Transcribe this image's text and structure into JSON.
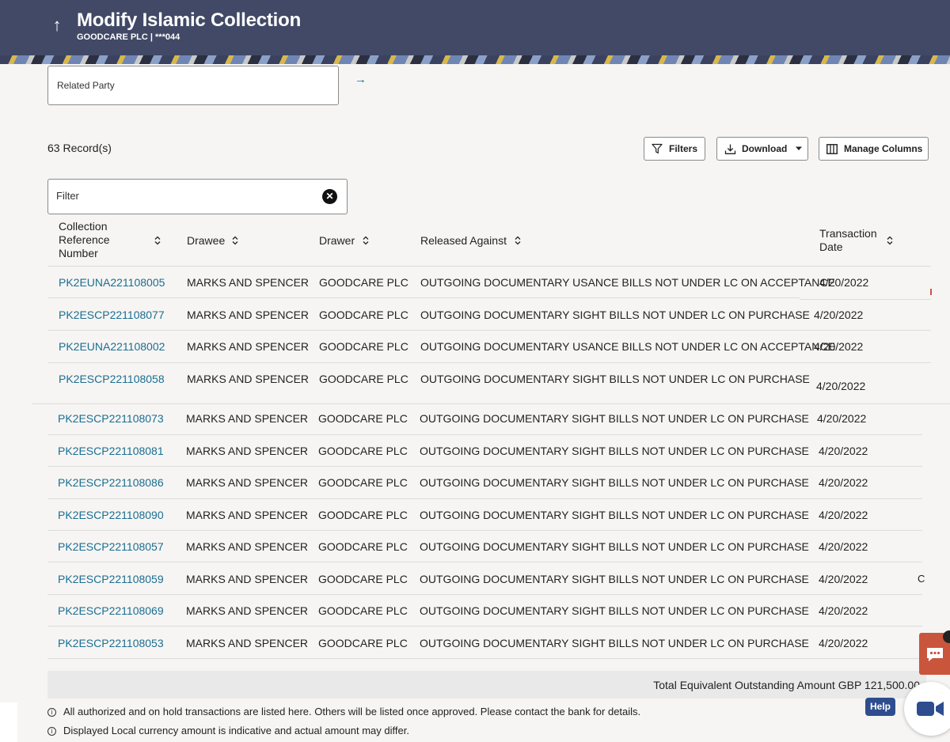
{
  "header": {
    "back_icon": "up-arrow-icon",
    "title": "Modify Islamic Collection",
    "subtitle": "GOODCARE PLC | ***044"
  },
  "search": {
    "related_party_label": "Related Party",
    "go_icon": "right-arrow-icon"
  },
  "toolbar": {
    "records": "63 Record(s)",
    "filters_label": "Filters",
    "download_label": "Download",
    "manage_columns_label": "Manage Columns"
  },
  "filter": {
    "placeholder": "Filter"
  },
  "table": {
    "columns": [
      "Collection Reference Number",
      "Drawee",
      "Drawer",
      "Released Against",
      "Transaction Date"
    ],
    "rows": [
      {
        "ref": "PK2EUNA221108005",
        "drawee": "MARKS AND SPENCER",
        "drawer": "GOODCARE PLC",
        "released": "OUTGOING DOCUMENTARY USANCE BILLS NOT UNDER LC ON ACCEPTANCE",
        "date": "4/20/2022"
      },
      {
        "ref": "PK2ESCP221108077",
        "drawee": "MARKS AND SPENCER",
        "drawer": "GOODCARE PLC",
        "released": "OUTGOING DOCUMENTARY SIGHT BILLS NOT UNDER LC ON PURCHASE",
        "date": "4/20/2022"
      },
      {
        "ref": "PK2EUNA221108002",
        "drawee": "MARKS AND SPENCER",
        "drawer": "GOODCARE PLC",
        "released": "OUTGOING DOCUMENTARY USANCE BILLS NOT UNDER LC ON ACCEPTANCE",
        "date": "4/20/2022"
      },
      {
        "ref": "PK2ESCP221108058",
        "drawee": "MARKS AND SPENCER",
        "drawer": "GOODCARE PLC",
        "released": "OUTGOING DOCUMENTARY SIGHT BILLS NOT UNDER LC ON PURCHASE",
        "date": "4/20/2022"
      },
      {
        "ref": "PK2ESCP221108073",
        "drawee": "MARKS AND SPENCER",
        "drawer": "GOODCARE PLC",
        "released": "OUTGOING DOCUMENTARY SIGHT BILLS NOT UNDER LC ON PURCHASE",
        "date": "4/20/2022"
      },
      {
        "ref": "PK2ESCP221108081",
        "drawee": "MARKS AND SPENCER",
        "drawer": "GOODCARE PLC",
        "released": "OUTGOING DOCUMENTARY SIGHT BILLS NOT UNDER LC ON PURCHASE",
        "date": "4/20/2022"
      },
      {
        "ref": "PK2ESCP221108086",
        "drawee": "MARKS AND SPENCER",
        "drawer": "GOODCARE PLC",
        "released": "OUTGOING DOCUMENTARY SIGHT BILLS NOT UNDER LC ON PURCHASE",
        "date": "4/20/2022"
      },
      {
        "ref": "PK2ESCP221108090",
        "drawee": "MARKS AND SPENCER",
        "drawer": "GOODCARE PLC",
        "released": "OUTGOING DOCUMENTARY SIGHT BILLS NOT UNDER LC ON PURCHASE",
        "date": "4/20/2022"
      },
      {
        "ref": "PK2ESCP221108057",
        "drawee": "MARKS AND SPENCER",
        "drawer": "GOODCARE PLC",
        "released": "OUTGOING DOCUMENTARY SIGHT BILLS NOT UNDER LC ON PURCHASE",
        "date": "4/20/2022"
      },
      {
        "ref": "PK2ESCP221108059",
        "drawee": "MARKS AND SPENCER",
        "drawer": "GOODCARE PLC",
        "released": "OUTGOING DOCUMENTARY SIGHT BILLS NOT UNDER LC ON PURCHASE",
        "date": "4/20/2022"
      },
      {
        "ref": "PK2ESCP221108069",
        "drawee": "MARKS AND SPENCER",
        "drawer": "GOODCARE PLC",
        "released": "OUTGOING DOCUMENTARY SIGHT BILLS NOT UNDER LC ON PURCHASE",
        "date": "4/20/2022"
      },
      {
        "ref": "PK2ESCP221108053",
        "drawee": "MARKS AND SPENCER",
        "drawer": "GOODCARE PLC",
        "released": "OUTGOING DOCUMENTARY SIGHT BILLS NOT UNDER LC ON PURCHASE",
        "date": "4/20/2022"
      }
    ]
  },
  "total": "Total Equivalent Outstanding Amount GBP 121,500.00",
  "notes": [
    "All authorized and on hold transactions are listed here. Others will be listed once approved. Please contact the bank for details.",
    "Displayed Local currency amount is indicative and actual amount may differ."
  ],
  "widgets": {
    "help_label": "Help",
    "edge_letter": "C"
  },
  "colors": {
    "header_bg": "#414966",
    "link": "#1b6e92",
    "chat": "#c9553d",
    "help": "#2e4d8f"
  }
}
